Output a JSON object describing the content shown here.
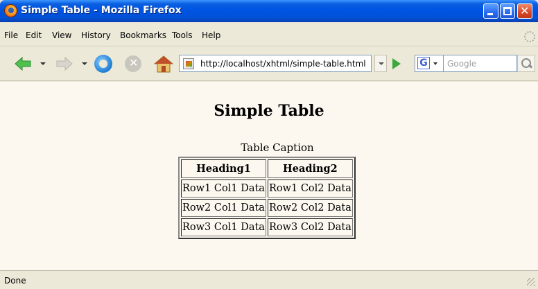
{
  "window": {
    "title": "Simple Table - Mozilla Firefox"
  },
  "menubar": {
    "items": [
      {
        "label": "File"
      },
      {
        "label": "Edit"
      },
      {
        "label": "View"
      },
      {
        "label": "History"
      },
      {
        "label": "Bookmarks"
      },
      {
        "label": "Tools"
      },
      {
        "label": "Help"
      }
    ]
  },
  "navbar": {
    "url": "http://localhost/xhtml/simple-table.html",
    "search_placeholder": "Google",
    "search_engine": "G",
    "icons": [
      "back-icon",
      "forward-icon",
      "reload-icon",
      "stop-icon",
      "home-icon",
      "go-icon",
      "search-icon"
    ]
  },
  "page": {
    "title": "Simple Table",
    "caption": "Table Caption",
    "headers": [
      "Heading1",
      "Heading2"
    ],
    "rows": [
      [
        "Row1 Col1 Data",
        "Row1 Col2 Data"
      ],
      [
        "Row2 Col1 Data",
        "Row2 Col2 Data"
      ],
      [
        "Row3 Col1 Data",
        "Row3 Col2 Data"
      ]
    ]
  },
  "statusbar": {
    "text": "Done"
  },
  "colors": {
    "titlebar": "#0054e3",
    "chrome": "#ece9d8",
    "content_background": "#fcf7ef"
  }
}
